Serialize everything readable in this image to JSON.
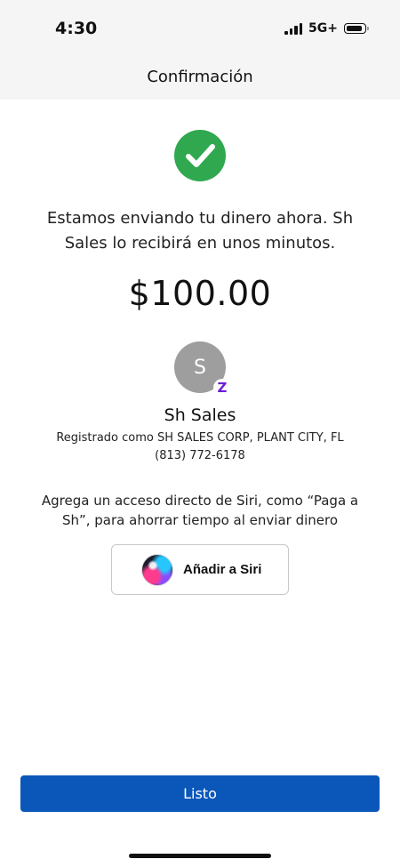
{
  "status_bar": {
    "time": "4:30",
    "network": "5G+",
    "signal_icon": "signal-bars-icon",
    "battery_icon": "battery-icon"
  },
  "nav": {
    "title": "Confirmación"
  },
  "confirmation": {
    "icon": "check-circle-icon",
    "icon_color": "#2fa84f",
    "message": "Estamos enviando tu dinero ahora. Sh Sales lo recibirá en unos minutos.",
    "amount": "$100.00"
  },
  "recipient": {
    "avatar_initial": "S",
    "badge": "Z",
    "badge_color": "#6d1ed4",
    "name": "Sh Sales",
    "registered_as": "Registrado como SH SALES CORP, PLANT CITY, FL",
    "phone": "(813) 772-6178"
  },
  "siri": {
    "prompt": "Agrega un acceso directo de Siri, como “Paga a Sh”, para ahorrar tiempo al enviar dinero",
    "button_label": "Añadir a Siri",
    "icon": "siri-icon"
  },
  "footer": {
    "done_label": "Listo",
    "button_color": "#0b57b9"
  }
}
